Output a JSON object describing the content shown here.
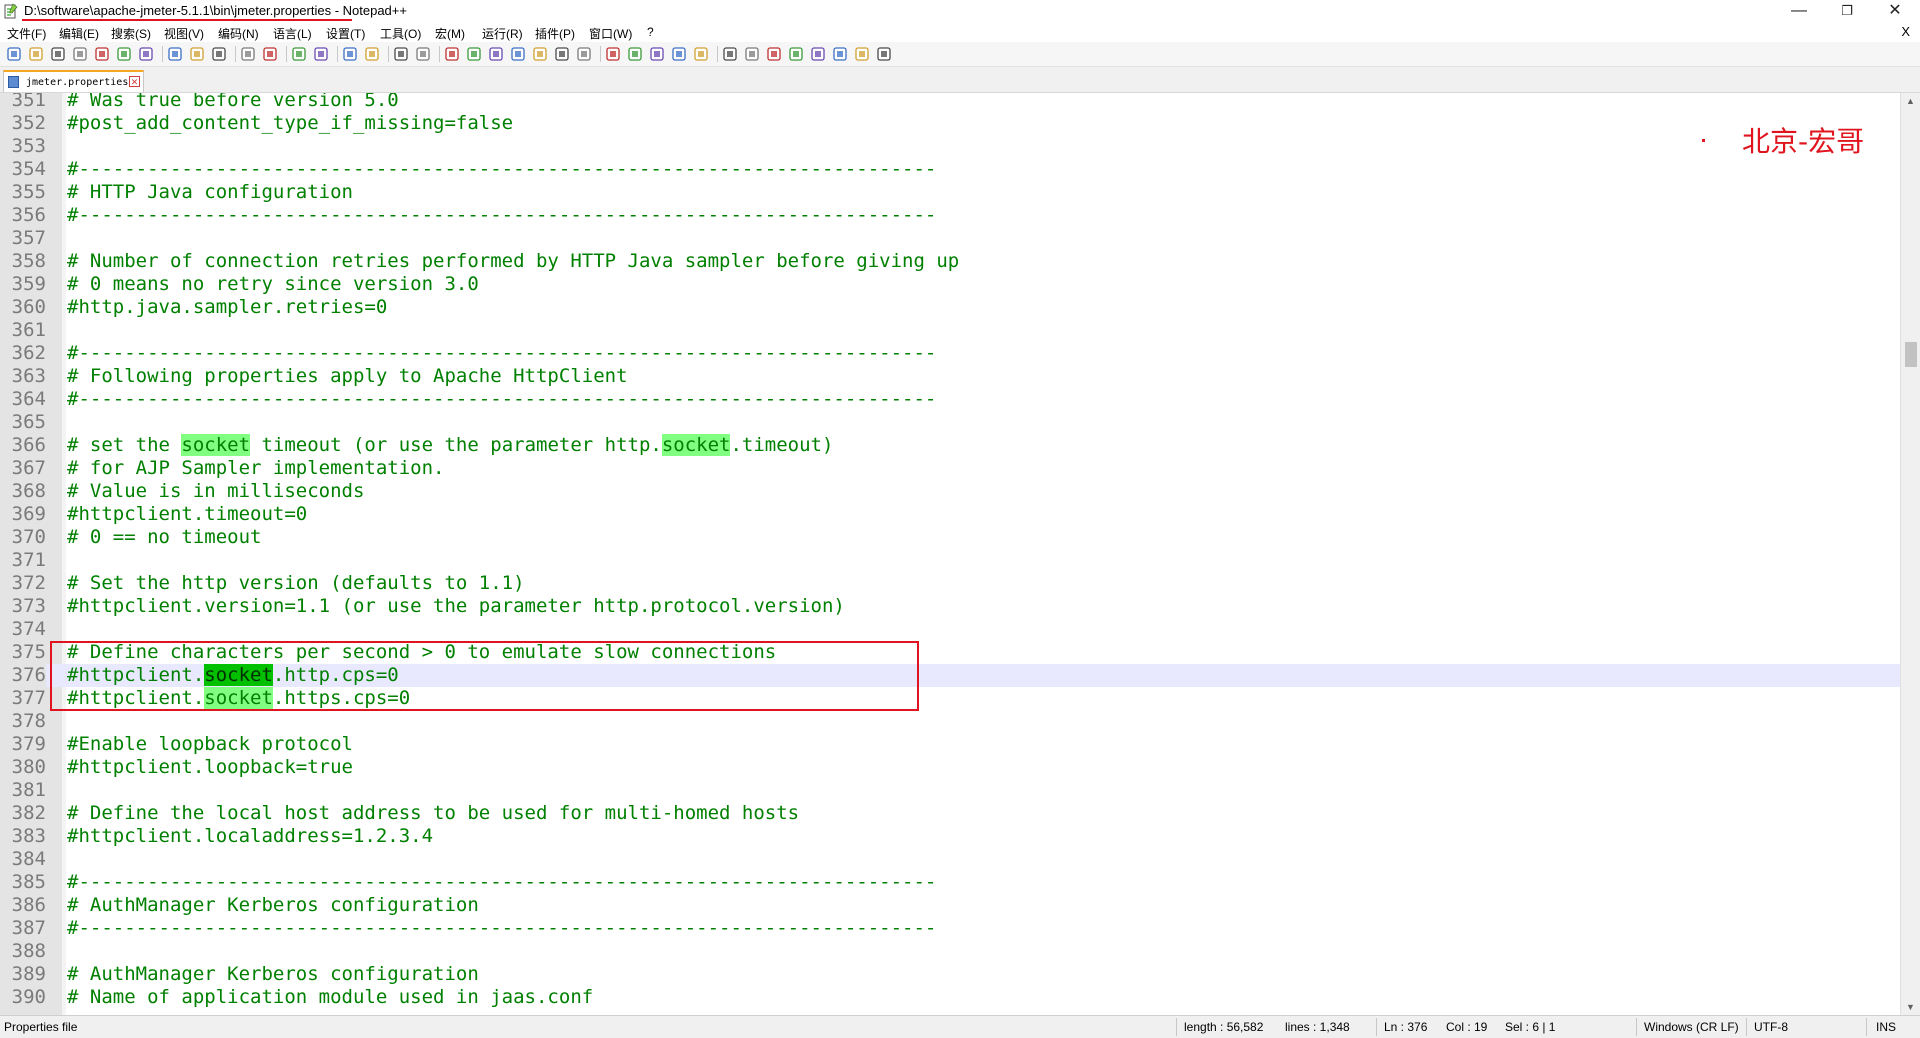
{
  "window": {
    "title": "D:\\software\\apache-jmeter-5.1.1\\bin\\jmeter.properties - Notepad++",
    "minimize": "—",
    "restore": "❐",
    "close": "✕"
  },
  "menu": {
    "items": [
      "文件(F)",
      "编辑(E)",
      "搜索(S)",
      "视图(V)",
      "编码(N)",
      "语言(L)",
      "设置(T)",
      "工具(O)",
      "宏(M)",
      "运行(R)",
      "插件(P)",
      "窗口(W)",
      "?"
    ],
    "close_doc": "X"
  },
  "tab": {
    "label": "jmeter.properties",
    "close": "✕"
  },
  "watermark": "北京-宏哥",
  "editor": {
    "lines": [
      {
        "n": "351",
        "t": "# Was true before version 5.0"
      },
      {
        "n": "352",
        "t": "#post_add_content_type_if_missing=false"
      },
      {
        "n": "353",
        "t": ""
      },
      {
        "n": "354",
        "t": "#---------------------------------------------------------------------------"
      },
      {
        "n": "355",
        "t": "# HTTP Java configuration"
      },
      {
        "n": "356",
        "t": "#---------------------------------------------------------------------------"
      },
      {
        "n": "357",
        "t": ""
      },
      {
        "n": "358",
        "t": "# Number of connection retries performed by HTTP Java sampler before giving up"
      },
      {
        "n": "359",
        "t": "# 0 means no retry since version 3.0"
      },
      {
        "n": "360",
        "t": "#http.java.sampler.retries=0"
      },
      {
        "n": "361",
        "t": ""
      },
      {
        "n": "362",
        "t": "#---------------------------------------------------------------------------"
      },
      {
        "n": "363",
        "t": "# Following properties apply to Apache HttpClient"
      },
      {
        "n": "364",
        "t": "#---------------------------------------------------------------------------"
      },
      {
        "n": "365",
        "t": ""
      },
      {
        "n": "366",
        "t": "# set the socket timeout (or use the parameter http.socket.timeout)"
      },
      {
        "n": "367",
        "t": "# for AJP Sampler implementation."
      },
      {
        "n": "368",
        "t": "# Value is in milliseconds"
      },
      {
        "n": "369",
        "t": "#httpclient.timeout=0"
      },
      {
        "n": "370",
        "t": "# 0 == no timeout"
      },
      {
        "n": "371",
        "t": ""
      },
      {
        "n": "372",
        "t": "# Set the http version (defaults to 1.1)"
      },
      {
        "n": "373",
        "t": "#httpclient.version=1.1 (or use the parameter http.protocol.version)"
      },
      {
        "n": "374",
        "t": ""
      },
      {
        "n": "375",
        "t": "# Define characters per second > 0 to emulate slow connections"
      },
      {
        "n": "376",
        "t": "#httpclient.socket.http.cps=0"
      },
      {
        "n": "377",
        "t": "#httpclient.socket.https.cps=0"
      },
      {
        "n": "378",
        "t": ""
      },
      {
        "n": "379",
        "t": "#Enable loopback protocol"
      },
      {
        "n": "380",
        "t": "#httpclient.loopback=true"
      },
      {
        "n": "381",
        "t": ""
      },
      {
        "n": "382",
        "t": "# Define the local host address to be used for multi-homed hosts"
      },
      {
        "n": "383",
        "t": "#httpclient.localaddress=1.2.3.4"
      },
      {
        "n": "384",
        "t": ""
      },
      {
        "n": "385",
        "t": "#---------------------------------------------------------------------------"
      },
      {
        "n": "386",
        "t": "# AuthManager Kerberos configuration"
      },
      {
        "n": "387",
        "t": "#---------------------------------------------------------------------------"
      },
      {
        "n": "388",
        "t": ""
      },
      {
        "n": "389",
        "t": "# AuthManager Kerberos configuration"
      },
      {
        "n": "390",
        "t": "# Name of application module used in jaas.conf"
      }
    ],
    "highlight_word": "socket",
    "current_line": "376"
  },
  "status": {
    "filetype": "Properties file",
    "length": "length : 56,582",
    "lines": "lines : 1,348",
    "ln": "Ln : 376",
    "col": "Col : 19",
    "sel": "Sel : 6 | 1",
    "eol": "Windows (CR LF)",
    "encoding": "UTF-8",
    "mode": "INS"
  },
  "colors": {
    "comment": "#008000",
    "smart_highlight": "#80ff80",
    "annotation_red": "#e0141e",
    "current_line": "#e8e8ff"
  },
  "toolbar_icons": [
    "new-file-icon",
    "open-file-icon",
    "save-icon",
    "save-all-icon",
    "close-icon",
    "close-all-icon",
    "print-icon",
    "cut-icon",
    "copy-icon",
    "paste-icon",
    "undo-icon",
    "redo-icon",
    "find-icon",
    "replace-icon",
    "zoom-in-icon",
    "zoom-out-icon",
    "sync-vertical-icon",
    "sync-horizontal-icon",
    "word-wrap-icon",
    "show-all-chars-icon",
    "indent-guide-icon",
    "doc-map-icon",
    "function-list-icon",
    "folder-workspace-icon",
    "monitoring-icon",
    "record-macro-icon",
    "stop-record-icon",
    "play-macro-icon",
    "run-macro-multiple-icon",
    "save-macro-icon",
    "tb-extra-1-icon",
    "tb-extra-2-icon",
    "tb-extra-3-icon",
    "tb-extra-4-icon",
    "tb-extra-5-icon",
    "tb-extra-6-icon",
    "tb-extra-7-icon",
    "tb-extra-8-icon"
  ]
}
